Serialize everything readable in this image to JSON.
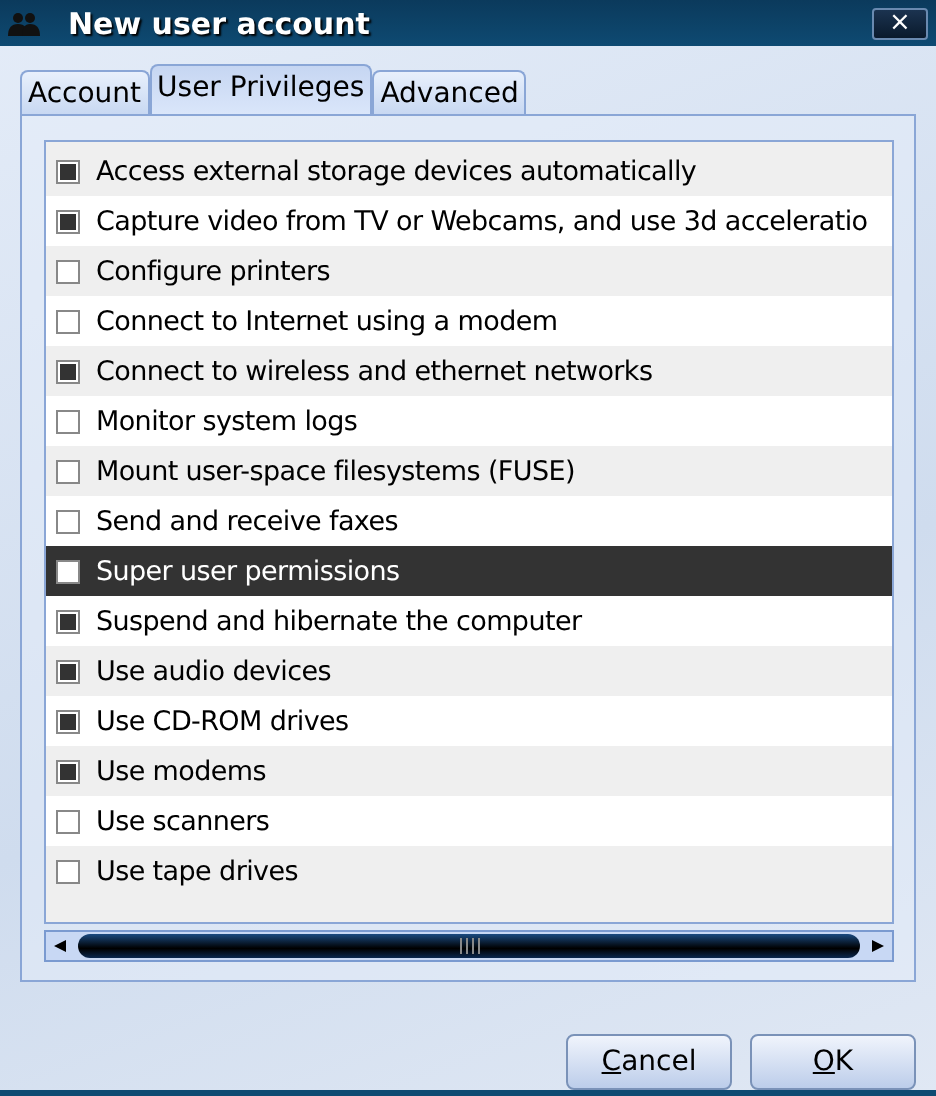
{
  "window": {
    "title": "New user account",
    "close": "×"
  },
  "tabs": [
    {
      "label": "Account",
      "selected": false
    },
    {
      "label": "User Privileges",
      "selected": true
    },
    {
      "label": "Advanced",
      "selected": false
    }
  ],
  "privileges": [
    {
      "label": "Access external storage devices automatically",
      "checked": true,
      "selected": false
    },
    {
      "label": "Capture video from TV or Webcams, and use 3d acceleratio",
      "checked": true,
      "selected": false
    },
    {
      "label": "Configure printers",
      "checked": false,
      "selected": false
    },
    {
      "label": "Connect to Internet using a modem",
      "checked": false,
      "selected": false
    },
    {
      "label": "Connect to wireless and ethernet networks",
      "checked": true,
      "selected": false
    },
    {
      "label": "Monitor system logs",
      "checked": false,
      "selected": false
    },
    {
      "label": "Mount user-space filesystems (FUSE)",
      "checked": false,
      "selected": false
    },
    {
      "label": "Send and receive faxes",
      "checked": false,
      "selected": false
    },
    {
      "label": "Super user permissions",
      "checked": false,
      "selected": true
    },
    {
      "label": "Suspend and hibernate the computer",
      "checked": true,
      "selected": false
    },
    {
      "label": "Use audio devices",
      "checked": true,
      "selected": false
    },
    {
      "label": "Use CD-ROM drives",
      "checked": true,
      "selected": false
    },
    {
      "label": "Use modems",
      "checked": true,
      "selected": false
    },
    {
      "label": "Use scanners",
      "checked": false,
      "selected": false
    },
    {
      "label": "Use tape drives",
      "checked": false,
      "selected": false
    }
  ],
  "buttons": [
    {
      "mnemonic": "C",
      "rest": "ancel"
    },
    {
      "mnemonic": "O",
      "rest": "K"
    }
  ]
}
